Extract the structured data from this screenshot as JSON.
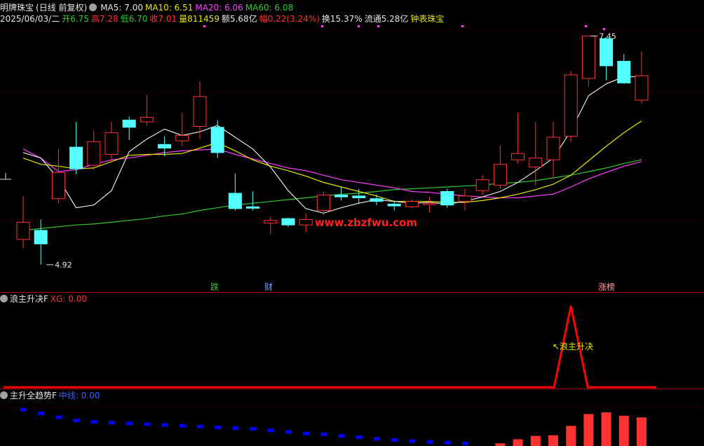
{
  "header": {
    "stock_name": "明牌珠宝",
    "period": "(日线 前复权)",
    "ma5": "MA5: 7.00",
    "ma10": "MA10: 6.51",
    "ma20": "MA20: 6.06",
    "ma60": "MA60: 6.08",
    "date": "2025/06/03/二",
    "open": "开6.75",
    "high": "高7.28",
    "low": "低6.70",
    "close": "收7.01",
    "volume": "量811459",
    "amount": "额5.68亿",
    "change": "幅0.22(3.24%)",
    "turnover": "换15.37%",
    "float_cap": "流通5.28亿",
    "sector": "钟表珠宝"
  },
  "panel2": {
    "title": "浪主升决F",
    "value": "XG: 0.00",
    "signal_label": "浪主升决"
  },
  "panel3": {
    "title": "主升全趋势F",
    "value": "中线: 0.00"
  },
  "markers": {
    "m1": "跌",
    "m2": "财",
    "m3": "涨榜"
  },
  "price_labels": {
    "high": "7.45",
    "low": "4.92"
  },
  "watermark": "www.zbzfwu.com",
  "colors": {
    "up": "#ff3232",
    "down": "#54ffff",
    "ma5": "#e6e6e6",
    "ma10": "#e6e600",
    "ma20": "#ff3cff",
    "ma60": "#32c832",
    "signal": "#ff0000",
    "blue_bar": "#0000ff"
  },
  "chart_data": {
    "type": "candlestick",
    "ylim": [
      4.75,
      7.6
    ],
    "candles": [
      {
        "o": 5.2,
        "c": 5.39,
        "h": 5.68,
        "l": 5.1
      },
      {
        "o": 5.3,
        "c": 5.15,
        "h": 5.42,
        "l": 4.92
      },
      {
        "o": 5.65,
        "c": 5.94,
        "h": 6.2,
        "l": 5.6
      },
      {
        "o": 6.22,
        "c": 5.98,
        "h": 6.5,
        "l": 5.92
      },
      {
        "o": 6.02,
        "c": 6.28,
        "h": 6.4,
        "l": 5.97
      },
      {
        "o": 6.14,
        "c": 6.38,
        "h": 6.5,
        "l": 6.05
      },
      {
        "o": 6.52,
        "c": 6.44,
        "h": 6.56,
        "l": 6.3
      },
      {
        "o": 6.5,
        "c": 6.55,
        "h": 6.8,
        "l": 6.46
      },
      {
        "o": 6.25,
        "c": 6.21,
        "h": 6.34,
        "l": 6.12
      },
      {
        "o": 6.29,
        "c": 6.35,
        "h": 6.6,
        "l": 6.23
      },
      {
        "o": 6.45,
        "c": 6.78,
        "h": 6.95,
        "l": 6.31
      },
      {
        "o": 6.44,
        "c": 6.16,
        "h": 6.52,
        "l": 6.1
      },
      {
        "o": 5.71,
        "c": 5.54,
        "h": 5.93,
        "l": 5.52
      },
      {
        "o": 5.56,
        "c": 5.55,
        "h": 5.73,
        "l": 5.52
      },
      {
        "o": 5.38,
        "c": 5.41,
        "h": 5.45,
        "l": 5.26
      },
      {
        "o": 5.43,
        "c": 5.36,
        "h": 5.44,
        "l": 5.34
      },
      {
        "o": 5.36,
        "c": 5.42,
        "h": 5.48,
        "l": 5.28
      },
      {
        "o": 5.52,
        "c": 5.69,
        "h": 5.73,
        "l": 5.47
      },
      {
        "o": 5.69,
        "c": 5.67,
        "h": 5.78,
        "l": 5.63
      },
      {
        "o": 5.68,
        "c": 5.66,
        "h": 5.76,
        "l": 5.59
      },
      {
        "o": 5.65,
        "c": 5.62,
        "h": 5.7,
        "l": 5.58
      },
      {
        "o": 5.59,
        "c": 5.57,
        "h": 5.63,
        "l": 5.52
      },
      {
        "o": 5.56,
        "c": 5.62,
        "h": 5.64,
        "l": 5.55
      },
      {
        "o": 5.6,
        "c": 5.6,
        "h": 5.67,
        "l": 5.5
      },
      {
        "o": 5.73,
        "c": 5.58,
        "h": 5.76,
        "l": 5.55
      },
      {
        "o": 5.62,
        "c": 5.68,
        "h": 5.76,
        "l": 5.52
      },
      {
        "o": 5.74,
        "c": 5.86,
        "h": 5.91,
        "l": 5.69
      },
      {
        "o": 5.8,
        "c": 6.03,
        "h": 6.24,
        "l": 5.76
      },
      {
        "o": 6.08,
        "c": 6.15,
        "h": 6.6,
        "l": 6.04
      },
      {
        "o": 6.0,
        "c": 6.1,
        "h": 6.5,
        "l": 5.8
      },
      {
        "o": 6.08,
        "c": 6.33,
        "h": 6.5,
        "l": 5.87
      },
      {
        "o": 6.34,
        "c": 7.02,
        "h": 7.06,
        "l": 6.28
      },
      {
        "o": 6.98,
        "c": 7.45,
        "h": 7.45,
        "l": 6.89
      },
      {
        "o": 7.42,
        "c": 7.12,
        "h": 7.44,
        "l": 6.96
      },
      {
        "o": 7.17,
        "c": 6.93,
        "h": 7.25,
        "l": 6.92
      },
      {
        "o": 6.74,
        "c": 7.01,
        "h": 7.28,
        "l": 6.7
      }
    ],
    "ma5": [
      6.16,
      6.1,
      5.87,
      5.55,
      5.58,
      5.74,
      6.17,
      6.31,
      6.42,
      6.35,
      6.39,
      6.46,
      6.33,
      6.2,
      6.0,
      5.74,
      5.54,
      5.49,
      5.55,
      5.6,
      5.64,
      5.62,
      5.6,
      5.61,
      5.59,
      5.62,
      5.67,
      5.73,
      5.83,
      5.96,
      6.1,
      6.4,
      6.79,
      6.92,
      7.0,
      7.0
    ],
    "ma10": [
      6.1,
      6.03,
      6.01,
      5.98,
      5.99,
      6.06,
      6.13,
      6.14,
      6.14,
      6.15,
      6.21,
      6.27,
      6.18,
      6.08,
      6.01,
      5.96,
      5.9,
      5.83,
      5.78,
      5.73,
      5.68,
      5.62,
      5.62,
      5.62,
      5.61,
      5.61,
      5.63,
      5.66,
      5.7,
      5.75,
      5.81,
      5.91,
      6.07,
      6.23,
      6.38,
      6.51
    ],
    "ma20": [
      6.2,
      6.1,
      5.95,
      5.97,
      6.03,
      6.08,
      6.1,
      6.13,
      6.16,
      6.18,
      6.19,
      6.2,
      6.14,
      6.09,
      6.04,
      5.99,
      5.96,
      5.91,
      5.86,
      5.83,
      5.8,
      5.77,
      5.73,
      5.72,
      5.7,
      5.68,
      5.67,
      5.66,
      5.66,
      5.68,
      5.7,
      5.78,
      5.87,
      5.94,
      6.01,
      6.06
    ],
    "ma60": [
      5.3,
      5.32,
      5.34,
      5.36,
      5.37,
      5.39,
      5.41,
      5.43,
      5.46,
      5.48,
      5.52,
      5.55,
      5.58,
      5.6,
      5.62,
      5.64,
      5.66,
      5.68,
      5.7,
      5.71,
      5.73,
      5.75,
      5.76,
      5.77,
      5.78,
      5.79,
      5.8,
      5.82,
      5.83,
      5.85,
      5.88,
      5.91,
      5.95,
      5.99,
      6.04,
      6.08
    ],
    "xg": [
      0,
      0,
      0,
      0,
      0,
      0,
      0,
      0,
      0,
      0,
      0,
      0,
      0,
      0,
      0,
      0,
      0,
      0,
      0,
      0,
      0,
      0,
      0,
      0,
      0,
      0,
      0,
      0,
      0,
      0,
      0,
      1,
      0,
      0,
      0,
      0
    ],
    "trend_down": [
      0.9,
      0.8,
      0.7,
      0.62,
      0.58,
      0.56,
      0.54,
      0.52,
      0.5,
      0.48,
      0.46,
      0.44,
      0.42,
      0.4,
      0.36,
      0.32,
      0.28,
      0.26,
      0.22,
      0.18,
      0.14,
      0.11,
      0.08,
      0.06,
      0.04,
      0.02,
      0,
      0,
      0,
      0,
      0,
      0,
      0,
      0,
      0,
      0
    ],
    "trend_up": [
      0,
      0,
      0,
      0,
      0,
      0,
      0,
      0,
      0,
      0,
      0,
      0,
      0,
      0,
      0,
      0,
      0,
      0,
      0,
      0,
      0,
      0,
      0,
      0,
      0,
      0,
      0,
      0.08,
      0.2,
      0.3,
      0.32,
      0.6,
      0.95,
      1.0,
      0.9,
      0.85
    ]
  }
}
